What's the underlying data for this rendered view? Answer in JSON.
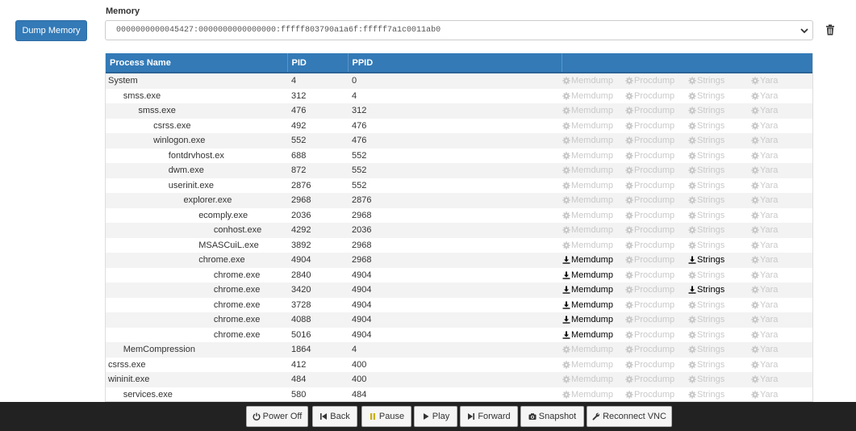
{
  "dump_button_label": "Dump Memory",
  "memory": {
    "label": "Memory",
    "selected": "0000000000045427:0000000000000000:fffff803790a1a6f:fffff7a1c0011ab0"
  },
  "table": {
    "headers": [
      "Process Name",
      "PID",
      "PPID",
      ""
    ],
    "action_labels": {
      "memdump": "Memdump",
      "procdump": "Procdump",
      "strings": "Strings",
      "yara": "Yara"
    },
    "rows": [
      {
        "name": "System",
        "depth": 0,
        "pid": "4",
        "ppid": "0",
        "memdump": false,
        "strings": false
      },
      {
        "name": "smss.exe",
        "depth": 1,
        "pid": "312",
        "ppid": "4",
        "memdump": false,
        "strings": false
      },
      {
        "name": "smss.exe",
        "depth": 2,
        "pid": "476",
        "ppid": "312",
        "memdump": false,
        "strings": false
      },
      {
        "name": "csrss.exe",
        "depth": 3,
        "pid": "492",
        "ppid": "476",
        "memdump": false,
        "strings": false
      },
      {
        "name": "winlogon.exe",
        "depth": 3,
        "pid": "552",
        "ppid": "476",
        "memdump": false,
        "strings": false
      },
      {
        "name": "fontdrvhost.ex",
        "depth": 4,
        "pid": "688",
        "ppid": "552",
        "memdump": false,
        "strings": false
      },
      {
        "name": "dwm.exe",
        "depth": 4,
        "pid": "872",
        "ppid": "552",
        "memdump": false,
        "strings": false
      },
      {
        "name": "userinit.exe",
        "depth": 4,
        "pid": "2876",
        "ppid": "552",
        "memdump": false,
        "strings": false
      },
      {
        "name": "explorer.exe",
        "depth": 5,
        "pid": "2968",
        "ppid": "2876",
        "memdump": false,
        "strings": false
      },
      {
        "name": "ecomply.exe",
        "depth": 6,
        "pid": "2036",
        "ppid": "2968",
        "memdump": false,
        "strings": false
      },
      {
        "name": "conhost.exe",
        "depth": 7,
        "pid": "4292",
        "ppid": "2036",
        "memdump": false,
        "strings": false
      },
      {
        "name": "MSASCuiL.exe",
        "depth": 6,
        "pid": "3892",
        "ppid": "2968",
        "memdump": false,
        "strings": false
      },
      {
        "name": "chrome.exe",
        "depth": 6,
        "pid": "4904",
        "ppid": "2968",
        "memdump": true,
        "strings": true
      },
      {
        "name": "chrome.exe",
        "depth": 7,
        "pid": "2840",
        "ppid": "4904",
        "memdump": true,
        "strings": false
      },
      {
        "name": "chrome.exe",
        "depth": 7,
        "pid": "3420",
        "ppid": "4904",
        "memdump": true,
        "strings": true
      },
      {
        "name": "chrome.exe",
        "depth": 7,
        "pid": "3728",
        "ppid": "4904",
        "memdump": true,
        "strings": false
      },
      {
        "name": "chrome.exe",
        "depth": 7,
        "pid": "4088",
        "ppid": "4904",
        "memdump": true,
        "strings": false
      },
      {
        "name": "chrome.exe",
        "depth": 7,
        "pid": "5016",
        "ppid": "4904",
        "memdump": true,
        "strings": false
      },
      {
        "name": "MemCompression",
        "depth": 1,
        "pid": "1864",
        "ppid": "4",
        "memdump": false,
        "strings": false
      },
      {
        "name": "csrss.exe",
        "depth": 0,
        "pid": "412",
        "ppid": "400",
        "memdump": false,
        "strings": false
      },
      {
        "name": "wininit.exe",
        "depth": 0,
        "pid": "484",
        "ppid": "400",
        "memdump": false,
        "strings": false
      },
      {
        "name": "services.exe",
        "depth": 1,
        "pid": "580",
        "ppid": "484",
        "memdump": false,
        "strings": false
      }
    ]
  },
  "vnc_controls": [
    {
      "name": "power-off-button",
      "label": "Power Off",
      "icon": "power-icon"
    },
    {
      "name": "back-button",
      "label": "Back",
      "icon": "back-icon"
    },
    {
      "name": "pause-button",
      "label": "Pause",
      "icon": "pause-icon"
    },
    {
      "name": "play-button",
      "label": "Play",
      "icon": "play-icon"
    },
    {
      "name": "forward-button",
      "label": "Forward",
      "icon": "forward-icon"
    },
    {
      "name": "snapshot-button",
      "label": "Snapshot",
      "icon": "camera-icon"
    },
    {
      "name": "reconnect-vnc-button",
      "label": "Reconnect VNC",
      "icon": "wrench-icon"
    }
  ],
  "colors": {
    "header_bg": "#337ab7",
    "bar_bg": "#222222",
    "disabled_action": "#c9c9c9",
    "pause_icon": "#c9b000"
  }
}
